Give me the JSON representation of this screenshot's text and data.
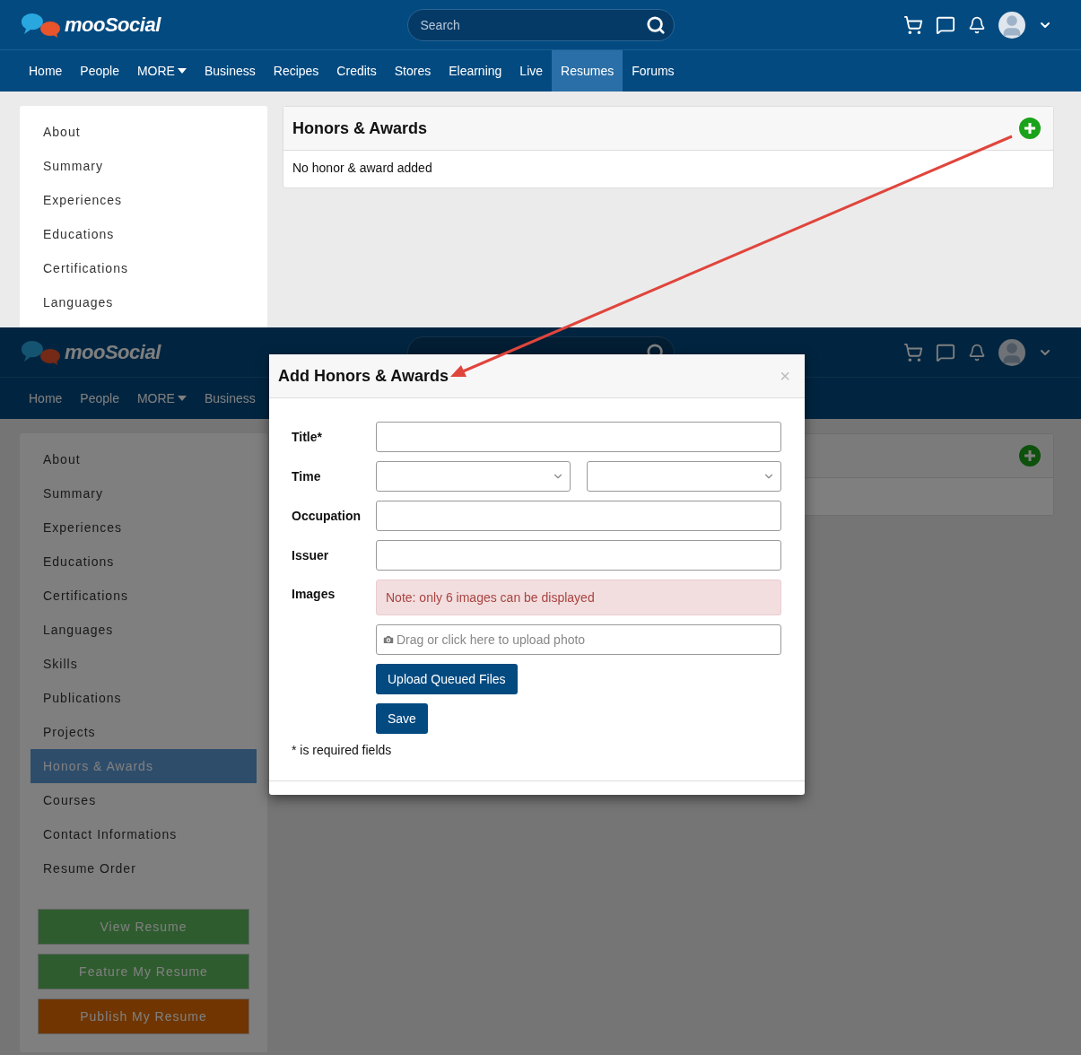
{
  "screens": [
    {
      "header": {
        "logo": "mooSocial",
        "search": {
          "placeholder": "Search"
        }
      },
      "nav": [
        {
          "label": "Home",
          "selected": false
        },
        {
          "label": "People",
          "selected": false
        },
        {
          "label": "MORE",
          "selected": false,
          "dropdown": true
        },
        {
          "label": "Business",
          "selected": false
        },
        {
          "label": "Recipes",
          "selected": false
        },
        {
          "label": "Credits",
          "selected": false
        },
        {
          "label": "Stores",
          "selected": false
        },
        {
          "label": "Elearning",
          "selected": false
        },
        {
          "label": "Live",
          "selected": false
        },
        {
          "label": "Resumes",
          "selected": true
        },
        {
          "label": "Forums",
          "selected": false
        }
      ],
      "sidebar": {
        "items": [
          {
            "label": "About",
            "selected": false
          },
          {
            "label": "Summary",
            "selected": false
          },
          {
            "label": "Experiences",
            "selected": false
          },
          {
            "label": "Educations",
            "selected": false
          },
          {
            "label": "Certifications",
            "selected": false
          },
          {
            "label": "Languages",
            "selected": false
          }
        ]
      },
      "panel": {
        "title": "Honors & Awards",
        "empty_text": "No honor & award added"
      }
    },
    {
      "header": {
        "logo": "mooSocial"
      },
      "nav": [
        {
          "label": "Home",
          "selected": false
        },
        {
          "label": "People",
          "selected": false
        },
        {
          "label": "MORE",
          "selected": false,
          "dropdown": true
        },
        {
          "label": "Business",
          "selected": false
        }
      ],
      "sidebar": {
        "items": [
          {
            "label": "About",
            "selected": false
          },
          {
            "label": "Summary",
            "selected": false
          },
          {
            "label": "Experiences",
            "selected": false
          },
          {
            "label": "Educations",
            "selected": false
          },
          {
            "label": "Certifications",
            "selected": false
          },
          {
            "label": "Languages",
            "selected": false
          },
          {
            "label": "Skills",
            "selected": false
          },
          {
            "label": "Publications",
            "selected": false
          },
          {
            "label": "Projects",
            "selected": false
          },
          {
            "label": "Honors & Awards",
            "selected": true
          },
          {
            "label": "Courses",
            "selected": false
          },
          {
            "label": "Contact Informations",
            "selected": false
          },
          {
            "label": "Resume Order",
            "selected": false
          }
        ],
        "buttons": [
          {
            "label": "View Resume",
            "kind": "view"
          },
          {
            "label": "Feature My Resume",
            "kind": "feature"
          },
          {
            "label": "Publish My Resume",
            "kind": "publish"
          }
        ]
      },
      "modal": {
        "title": "Add Honors & Awards",
        "close": "×",
        "fields": [
          {
            "label": "Title*",
            "kind": "text"
          },
          {
            "label": "Time",
            "kind": "date"
          },
          {
            "label": "Occupation",
            "kind": "text"
          },
          {
            "label": "Issuer",
            "kind": "text"
          },
          {
            "label": "Images",
            "kind": "images",
            "note": "Note: only 6 images can be displayed",
            "upload_placeholder": "Drag or click here to upload photo",
            "upload_button": "Upload Queued Files"
          }
        ],
        "submit": "Save",
        "footnote": "* is required fields"
      }
    }
  ]
}
